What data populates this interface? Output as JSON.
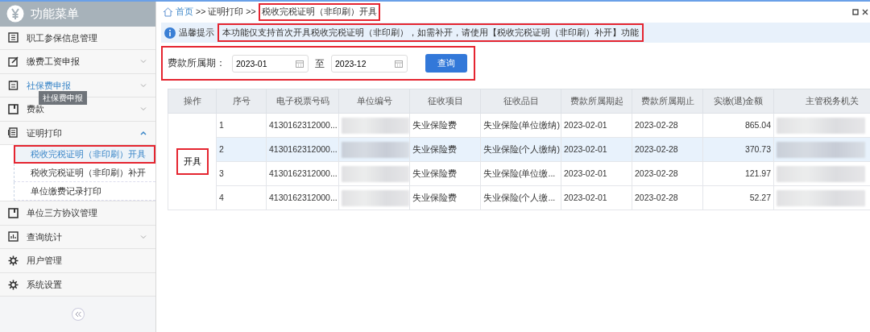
{
  "sidebar": {
    "title": "功能菜单",
    "items": [
      {
        "label": "职工参保信息管理",
        "hovered": false
      },
      {
        "label": "缴费工资申报",
        "expanded": false,
        "hovered": false
      },
      {
        "label": "社保费申报",
        "expanded": false,
        "hovered": true
      },
      {
        "label": "费款",
        "expanded": false,
        "hovered": false
      },
      {
        "label": "证明打印",
        "expanded": true,
        "hovered": false,
        "children": [
          {
            "label": "税收完税证明（非印刷）开具",
            "selected": true,
            "highlighted": true
          },
          {
            "label": "税收完税证明（非印刷）补开",
            "selected": false,
            "highlighted": false
          },
          {
            "label": "单位缴费记录打印",
            "selected": false,
            "highlighted": false
          }
        ]
      },
      {
        "label": "单位三方协议管理",
        "hovered": false
      },
      {
        "label": "查询统计",
        "expanded": false,
        "hovered": false
      },
      {
        "label": "用户管理",
        "hovered": false
      },
      {
        "label": "系统设置",
        "hovered": false
      }
    ],
    "tooltip": "社保费申报"
  },
  "breadcrumb": [
    {
      "label": "首页",
      "link": true,
      "highlighted": false
    },
    {
      "label": "证明打印",
      "link": false,
      "highlighted": false
    },
    {
      "label": "税收完税证明（非印刷）开具",
      "link": false,
      "highlighted": true
    }
  ],
  "breadcrumb_separator": ">>",
  "notice": {
    "label": "温馨提示",
    "text": "本功能仅支持首次开具税收完税证明（非印刷），如需补开，请使用【税收完税证明（非印刷）补开】功能",
    "highlighted": true
  },
  "filter": {
    "label": "费款所属期：",
    "from": "2023-01",
    "to_label": "至",
    "to": "2023-12",
    "button": "查询",
    "highlighted": true
  },
  "table": {
    "columns": [
      "操作",
      "序号",
      "电子税票号码",
      "单位编号",
      "征收项目",
      "征收品目",
      "费款所属期起",
      "费款所属期止",
      "实缴(退)金额",
      "主管税务机关"
    ],
    "action": {
      "highlighted": true
    },
    "rows": [
      {
        "selected": false,
        "cells": [
          {
            "text": "开具",
            "rowspan": 4
          },
          "1",
          "4130162312000...",
          "",
          "失业保险费",
          "失业保险(单位缴纳)",
          "2023-02-01",
          "2023-02-28",
          "865.04",
          ""
        ]
      },
      {
        "selected": true,
        "cells": [
          "2",
          "4130162312000...",
          "",
          "失业保险费",
          "失业保险(个人缴纳)",
          "2023-02-01",
          "2023-02-28",
          "370.73",
          ""
        ]
      },
      {
        "selected": false,
        "cells": [
          "3",
          "4130162312000...",
          "",
          "失业保险费",
          "失业保险(单位缴...",
          "2023-02-01",
          "2023-02-28",
          "121.97",
          ""
        ]
      },
      {
        "selected": false,
        "cells": [
          "4",
          "4130162312000...",
          "",
          "失业保险费",
          "失业保险(个人缴...",
          "2023-02-01",
          "2023-02-28",
          "52.27",
          ""
        ]
      }
    ]
  }
}
